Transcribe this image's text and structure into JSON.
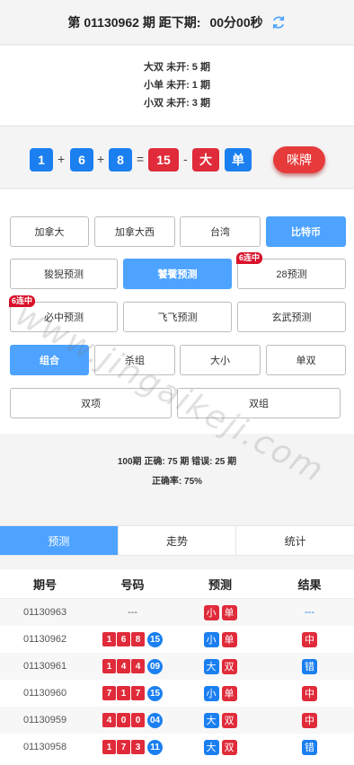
{
  "header": {
    "issue_prefix": "第",
    "issue": "01130962",
    "issue_suffix": "期 距下期:",
    "countdown": "00分00秒"
  },
  "missing": [
    "大双 未开: 5 期",
    "小单 未开: 1 期",
    "小双 未开: 3 期"
  ],
  "result": {
    "nums": [
      "1",
      "6",
      "8"
    ],
    "plus": "+",
    "equals": "=",
    "sum": "15",
    "dash": "-",
    "size": "大",
    "parity": "单",
    "mipai_label": "咪牌"
  },
  "regions": [
    "加拿大",
    "加拿大西",
    "台湾",
    "比特币"
  ],
  "predictors": [
    "狻猊预测",
    "饕餮预测",
    "28预测",
    "必中预测",
    "飞飞预测",
    "玄武预测"
  ],
  "hot_badge": "6连中",
  "play_types": [
    "组合",
    "杀组",
    "大小",
    "单双",
    "双项",
    "双组"
  ],
  "stats": {
    "line1": "100期 正确: 75 期 错误: 25 期",
    "line2": "正确率: 75%"
  },
  "tabs": [
    "预测",
    "走势",
    "统计"
  ],
  "table": {
    "headers": [
      "期号",
      "号码",
      "预测",
      "结果"
    ],
    "rows": [
      {
        "issue": "01130963",
        "pending": "---",
        "pred": [
          "小",
          "单"
        ],
        "result": "---"
      },
      {
        "issue": "01130962",
        "nums": [
          "1",
          "6",
          "8"
        ],
        "sum": "15",
        "pred": [
          "小",
          "单"
        ],
        "result": "中"
      },
      {
        "issue": "01130961",
        "nums": [
          "1",
          "4",
          "4"
        ],
        "sum": "09",
        "pred": [
          "大",
          "双"
        ],
        "result": "错"
      },
      {
        "issue": "01130960",
        "nums": [
          "7",
          "1",
          "7"
        ],
        "sum": "15",
        "pred": [
          "小",
          "单"
        ],
        "result": "中"
      },
      {
        "issue": "01130959",
        "nums": [
          "4",
          "0",
          "0"
        ],
        "sum": "04",
        "pred": [
          "大",
          "双"
        ],
        "result": "中"
      },
      {
        "issue": "01130958",
        "nums": [
          "1",
          "7",
          "3"
        ],
        "sum": "11",
        "pred": [
          "大",
          "双"
        ],
        "result": "错"
      }
    ]
  },
  "watermark": "www.jingaikeji.com",
  "colors": {
    "blue": "#1b7ff0",
    "red": "#e02b3a",
    "accent": "#4da3ff"
  }
}
